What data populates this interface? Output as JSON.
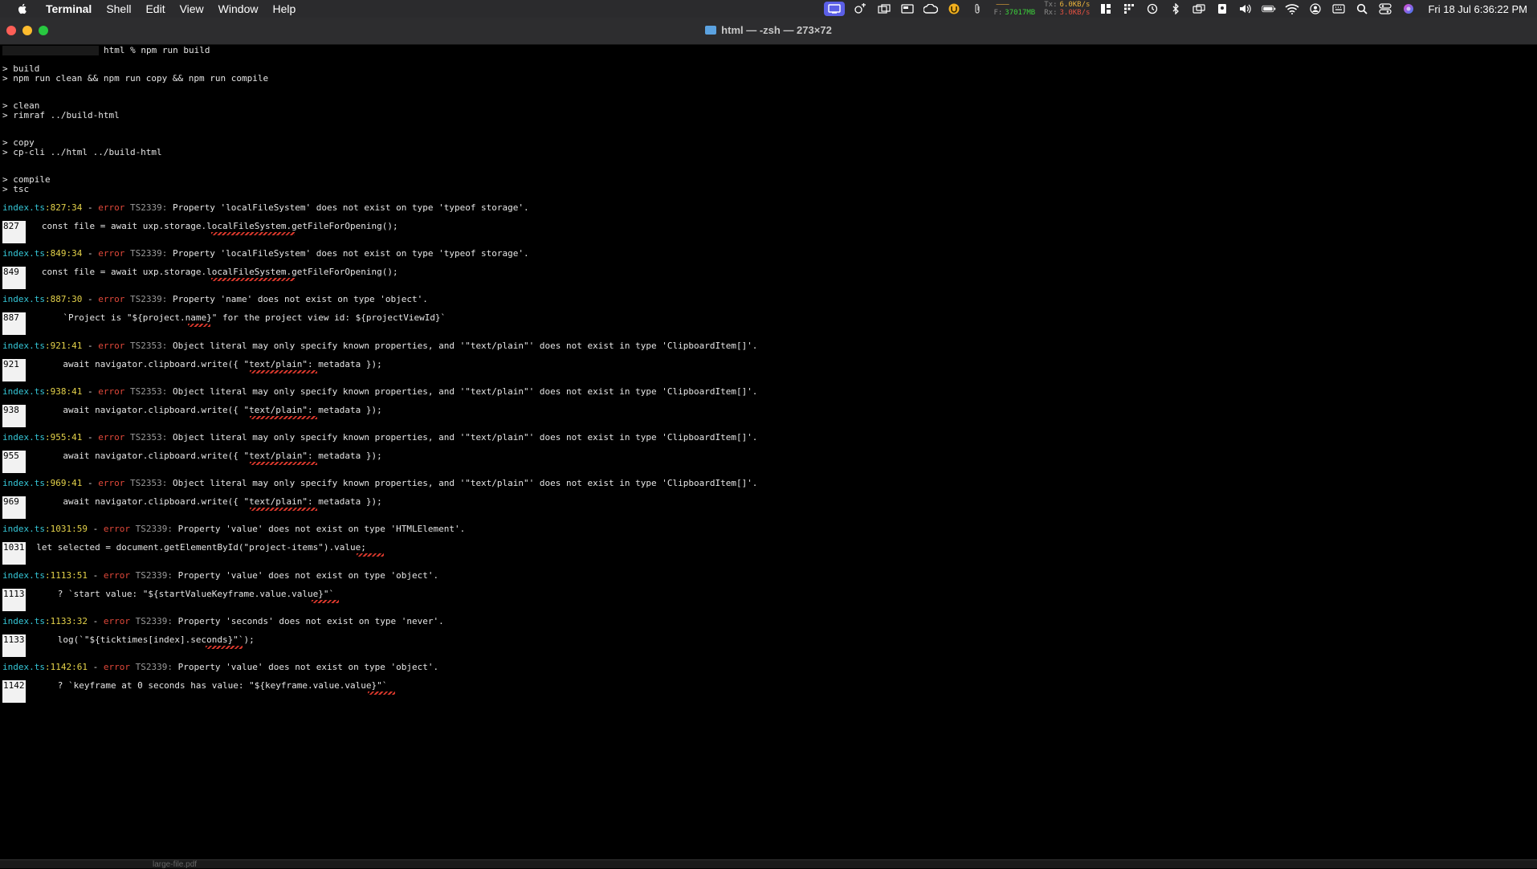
{
  "menubar": {
    "items": [
      "Terminal",
      "Shell",
      "Edit",
      "View",
      "Window",
      "Help"
    ],
    "network": {
      "tx_label": "Tx:",
      "tx_value": "6.0KB/s",
      "rx_label": "Rx:",
      "rx_value": "3.0KB/s",
      "mem_label": "F:",
      "mem_value": "37017MB"
    },
    "clock": "Fri 18 Jul  6:36:22 PM"
  },
  "window": {
    "title": "html — -zsh — 273×72"
  },
  "colors": {
    "cyan": "#35c6d6",
    "yellow": "#e4d24a",
    "red": "#e0483a"
  },
  "terminal": {
    "prompt": "html % npm run build",
    "build_lines": [
      "> build",
      "> npm run clean && npm run copy && npm run compile",
      "> clean",
      "> rimraf ../build-html",
      "> copy",
      "> cp-cli ../html ../build-html",
      "> compile",
      "> tsc"
    ],
    "errors": [
      {
        "file": "index.ts",
        "loc": ":827:34",
        "sep": " - ",
        "sev": "error",
        "code": " TS2339: ",
        "msg": "Property 'localFileSystem' does not exist on type 'typeof storage'.",
        "line_no": "827",
        "code_line": "   const file = await uxp.storage.localFileSystem.getFileForOpening();"
      },
      {
        "file": "index.ts",
        "loc": ":849:34",
        "sep": " - ",
        "sev": "error",
        "code": " TS2339: ",
        "msg": "Property 'localFileSystem' does not exist on type 'typeof storage'.",
        "line_no": "849",
        "code_line": "   const file = await uxp.storage.localFileSystem.getFileForOpening();"
      },
      {
        "file": "index.ts",
        "loc": ":887:30",
        "sep": " - ",
        "sev": "error",
        "code": " TS2339: ",
        "msg": "Property 'name' does not exist on type 'object'.",
        "line_no": "887",
        "code_line": "       `Project is \"${project.name}\" for the project view id: ${projectViewId}`"
      },
      {
        "file": "index.ts",
        "loc": ":921:41",
        "sep": " - ",
        "sev": "error",
        "code": " TS2353: ",
        "msg": "Object literal may only specify known properties, and '\"text/plain\"' does not exist in type 'ClipboardItem[]'.",
        "line_no": "921",
        "code_line": "       await navigator.clipboard.write({ \"text/plain\": metadata });"
      },
      {
        "file": "index.ts",
        "loc": ":938:41",
        "sep": " - ",
        "sev": "error",
        "code": " TS2353: ",
        "msg": "Object literal may only specify known properties, and '\"text/plain\"' does not exist in type 'ClipboardItem[]'.",
        "line_no": "938",
        "code_line": "       await navigator.clipboard.write({ \"text/plain\": metadata });"
      },
      {
        "file": "index.ts",
        "loc": ":955:41",
        "sep": " - ",
        "sev": "error",
        "code": " TS2353: ",
        "msg": "Object literal may only specify known properties, and '\"text/plain\"' does not exist in type 'ClipboardItem[]'.",
        "line_no": "955",
        "code_line": "       await navigator.clipboard.write({ \"text/plain\": metadata });"
      },
      {
        "file": "index.ts",
        "loc": ":969:41",
        "sep": " - ",
        "sev": "error",
        "code": " TS2353: ",
        "msg": "Object literal may only specify known properties, and '\"text/plain\"' does not exist in type 'ClipboardItem[]'.",
        "line_no": "969",
        "code_line": "       await navigator.clipboard.write({ \"text/plain\": metadata });"
      },
      {
        "file": "index.ts",
        "loc": ":1031:59",
        "sep": " - ",
        "sev": "error",
        "code": " TS2339: ",
        "msg": "Property 'value' does not exist on type 'HTMLElement'.",
        "line_no": "1031",
        "code_line": "  let selected = document.getElementById(\"project-items\").value;"
      },
      {
        "file": "index.ts",
        "loc": ":1113:51",
        "sep": " - ",
        "sev": "error",
        "code": " TS2339: ",
        "msg": "Property 'value' does not exist on type 'object'.",
        "line_no": "1113",
        "code_line": "      ? `start value: \"${startValueKeyframe.value.value}\"`"
      },
      {
        "file": "index.ts",
        "loc": ":1133:32",
        "sep": " - ",
        "sev": "error",
        "code": " TS2339: ",
        "msg": "Property 'seconds' does not exist on type 'never'.",
        "line_no": "1133",
        "code_line": "      log(`\"${ticktimes[index].seconds}\"`);"
      },
      {
        "file": "index.ts",
        "loc": ":1142:61",
        "sep": " - ",
        "sev": "error",
        "code": " TS2339: ",
        "msg": "Property 'value' does not exist on type 'object'.",
        "line_no": "1142",
        "code_line": "      ? `keyframe at 0 seconds has value: \"${keyframe.value.value}\"`"
      }
    ]
  },
  "dock_hint": "large-file.pdf"
}
